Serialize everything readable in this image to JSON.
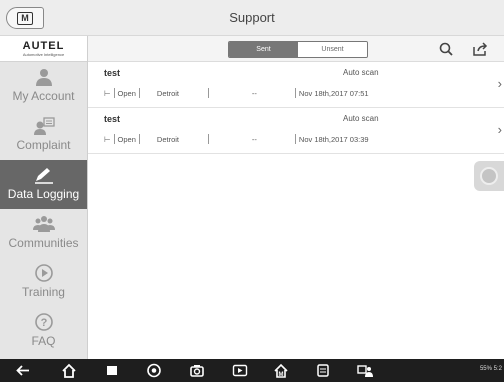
{
  "header": {
    "title": "Support"
  },
  "sidebar": {
    "brand": "AUTEL",
    "tagline": "Automotive Intelligence",
    "items": [
      {
        "label": "My Account",
        "icon": "person-icon"
      },
      {
        "label": "Complaint",
        "icon": "chat-person-icon"
      },
      {
        "label": "Data Logging",
        "icon": "edit-icon",
        "active": true
      },
      {
        "label": "Communities",
        "icon": "group-icon"
      },
      {
        "label": "Training",
        "icon": "play-icon"
      },
      {
        "label": "FAQ",
        "icon": "question-icon"
      }
    ]
  },
  "tabs": {
    "sent": "Sent",
    "unsent": "Unsent"
  },
  "sessions": [
    {
      "name": "test",
      "type": "Auto scan",
      "status": "Open",
      "location": "Detroit",
      "dash": "--",
      "date": "Nov 18th,2017 07:51"
    },
    {
      "name": "test",
      "type": "Auto scan",
      "status": "Open",
      "location": "Detroit",
      "dash": "--",
      "date": "Nov 18th,2017 03:39"
    }
  ],
  "status_bar": {
    "text": "55% 5:2"
  }
}
